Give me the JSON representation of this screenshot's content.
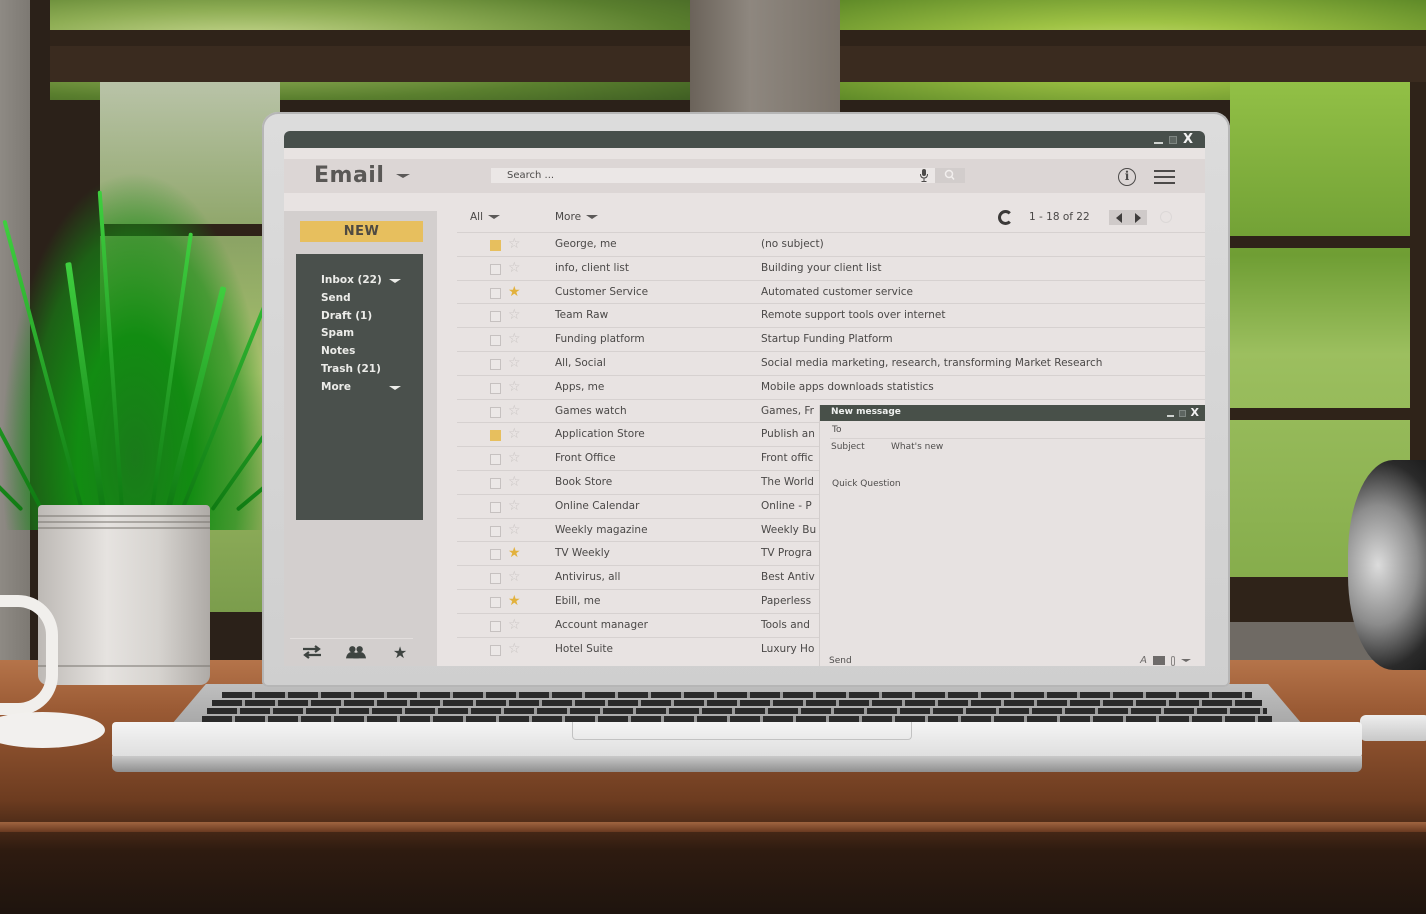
{
  "window": {
    "controls": {
      "minimize": "minimize",
      "maximize": "maximize",
      "close": "X"
    }
  },
  "header": {
    "app_title": "Email",
    "search_placeholder": "Search ...",
    "icons": [
      "chevron-down-icon",
      "microphone-icon",
      "search-icon",
      "info-icon",
      "hamburger-menu-icon"
    ]
  },
  "sidebar": {
    "new_button": "NEW",
    "folders": [
      {
        "label": "Inbox (22)",
        "has_caret": true
      },
      {
        "label": "Send"
      },
      {
        "label": "Draft (1)"
      },
      {
        "label": "Spam"
      },
      {
        "label": "Notes"
      },
      {
        "label": "Trash (21)"
      },
      {
        "label": "More",
        "has_caret": true
      }
    ],
    "bottom_tools": [
      "swap-arrows-icon",
      "contacts-icon",
      "star-icon"
    ]
  },
  "toolbar": {
    "all_label": "All",
    "more_label": "More",
    "page_count": "1 - 18 of 22"
  },
  "emails": [
    {
      "sender": "George, me",
      "subject": "(no subject)",
      "checked": true,
      "starred": false
    },
    {
      "sender": "info, client list",
      "subject": "Building your client list",
      "checked": false,
      "starred": false
    },
    {
      "sender": "Customer Service",
      "subject": "Automated customer service",
      "checked": false,
      "starred": true
    },
    {
      "sender": "Team Raw",
      "subject": "Remote support tools over internet",
      "checked": false,
      "starred": false
    },
    {
      "sender": "Funding platform",
      "subject": "Startup Funding Platform",
      "checked": false,
      "starred": false
    },
    {
      "sender": "All, Social",
      "subject": "Social media marketing, research, transforming Market Research",
      "checked": false,
      "starred": false
    },
    {
      "sender": "Apps, me",
      "subject": "Mobile apps downloads statistics",
      "checked": false,
      "starred": false
    },
    {
      "sender": "Games watch",
      "subject": "Games, Fr",
      "checked": false,
      "starred": false
    },
    {
      "sender": "Application Store",
      "subject": "Publish an",
      "checked": true,
      "starred": false
    },
    {
      "sender": "Front Office",
      "subject": "Front offic",
      "checked": false,
      "starred": false
    },
    {
      "sender": "Book Store",
      "subject": "The World",
      "checked": false,
      "starred": false
    },
    {
      "sender": "Online Calendar",
      "subject": "Online - P",
      "checked": false,
      "starred": false
    },
    {
      "sender": "Weekly magazine",
      "subject": "Weekly Bu",
      "checked": false,
      "starred": false
    },
    {
      "sender": "TV Weekly",
      "subject": "TV Progra",
      "checked": false,
      "starred": true
    },
    {
      "sender": "Antivirus, all",
      "subject": "Best Antiv",
      "checked": false,
      "starred": false
    },
    {
      "sender": "Ebill, me",
      "subject": "Paperless",
      "checked": false,
      "starred": true
    },
    {
      "sender": "Account manager",
      "subject": "Tools and",
      "checked": false,
      "starred": false
    },
    {
      "sender": "Hotel Suite",
      "subject": "Luxury Ho",
      "checked": false,
      "starred": false
    }
  ],
  "compose": {
    "title": "New message",
    "to_label": "To",
    "subject_label": "Subject",
    "subject_value": "What's new",
    "body": "Quick Question",
    "send_label": "Send",
    "format_label": "A"
  },
  "colors": {
    "accent": "#e7bf5e",
    "titlebar": "#474f4b",
    "sidebar_panel": "#4a504c",
    "star_on": "#e2b13c"
  }
}
